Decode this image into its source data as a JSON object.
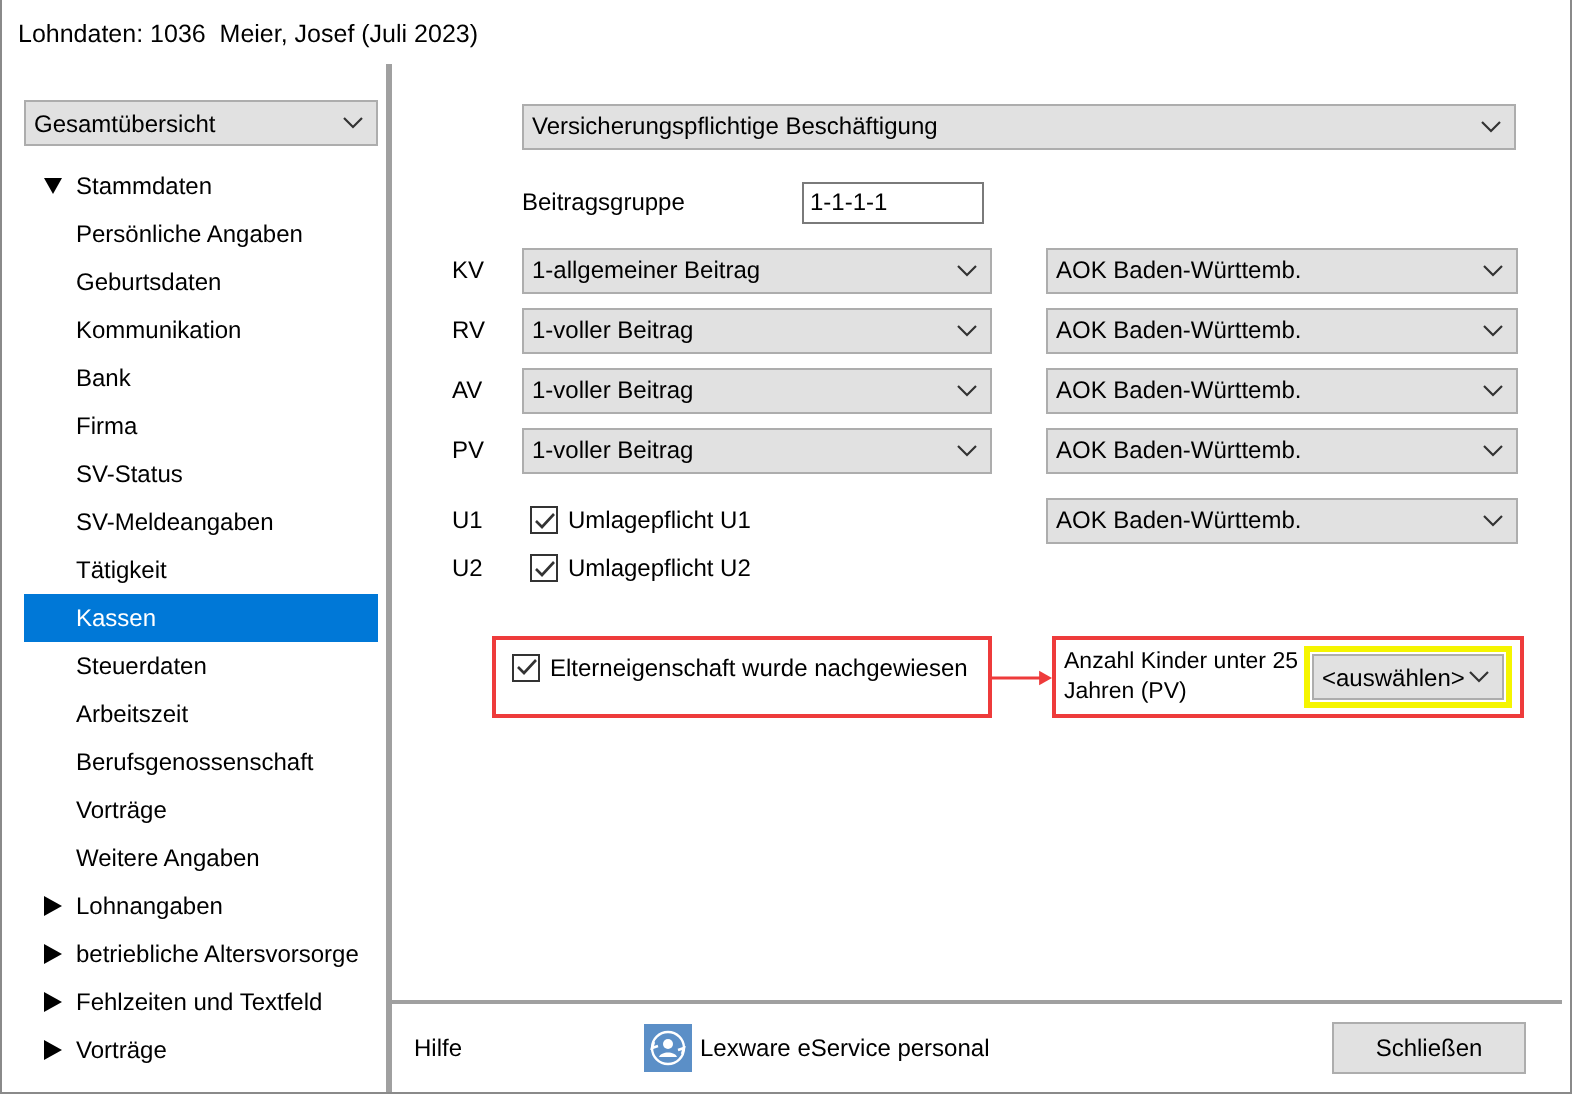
{
  "window": {
    "title": "Lohndaten: 1036  Meier, Josef (Juli 2023)"
  },
  "sidebar": {
    "view_select": "Gesamtübersicht",
    "tree": [
      {
        "label": "Stammdaten",
        "expanded": true,
        "selected": false,
        "children": [
          {
            "label": "Persönliche Angaben",
            "selected": false
          },
          {
            "label": "Geburtsdaten",
            "selected": false
          },
          {
            "label": "Kommunikation",
            "selected": false
          },
          {
            "label": "Bank",
            "selected": false
          },
          {
            "label": "Firma",
            "selected": false
          },
          {
            "label": "SV-Status",
            "selected": false
          },
          {
            "label": "SV-Meldeangaben",
            "selected": false
          },
          {
            "label": "Tätigkeit",
            "selected": false
          },
          {
            "label": "Kassen",
            "selected": true
          },
          {
            "label": "Steuerdaten",
            "selected": false
          },
          {
            "label": "Arbeitszeit",
            "selected": false
          },
          {
            "label": "Berufsgenossenschaft",
            "selected": false
          },
          {
            "label": "Vorträge",
            "selected": false
          },
          {
            "label": "Weitere Angaben",
            "selected": false
          }
        ]
      },
      {
        "label": "Lohnangaben",
        "expanded": false,
        "selected": false
      },
      {
        "label": "betriebliche Altersvorsorge",
        "expanded": false,
        "selected": false
      },
      {
        "label": "Fehlzeiten und Textfeld",
        "expanded": false,
        "selected": false
      },
      {
        "label": "Vorträge",
        "expanded": false,
        "selected": false
      }
    ]
  },
  "form": {
    "employment_select": "Versicherungspflichtige Beschäftigung",
    "beitragsgruppe": {
      "label": "Beitragsgruppe",
      "value": "1-1-1-1"
    },
    "insurance_rows": [
      {
        "label": "KV",
        "contribution": "1-allgemeiner Beitrag",
        "fund": "AOK Baden-Württemb."
      },
      {
        "label": "RV",
        "contribution": "1-voller Beitrag",
        "fund": "AOK Baden-Württemb."
      },
      {
        "label": "AV",
        "contribution": "1-voller Beitrag",
        "fund": "AOK Baden-Württemb."
      },
      {
        "label": "PV",
        "contribution": "1-voller Beitrag",
        "fund": "AOK Baden-Württemb."
      }
    ],
    "levy_rows": [
      {
        "label": "U1",
        "checkbox_label": "Umlagepflicht U1",
        "checked": true,
        "fund": "AOK Baden-Württemb."
      },
      {
        "label": "U2",
        "checkbox_label": "Umlagepflicht U2",
        "checked": true
      }
    ],
    "parent": {
      "checkbox_label": "Elterneigenschaft wurde nachgewiesen",
      "checked": true
    },
    "children_count": {
      "label": "Anzahl Kinder unter 25 Jahren (PV)",
      "value": "<auswählen>"
    }
  },
  "footer": {
    "help": "Hilfe",
    "eservice": "Lexware eService personal",
    "close_button": "Schließen"
  }
}
